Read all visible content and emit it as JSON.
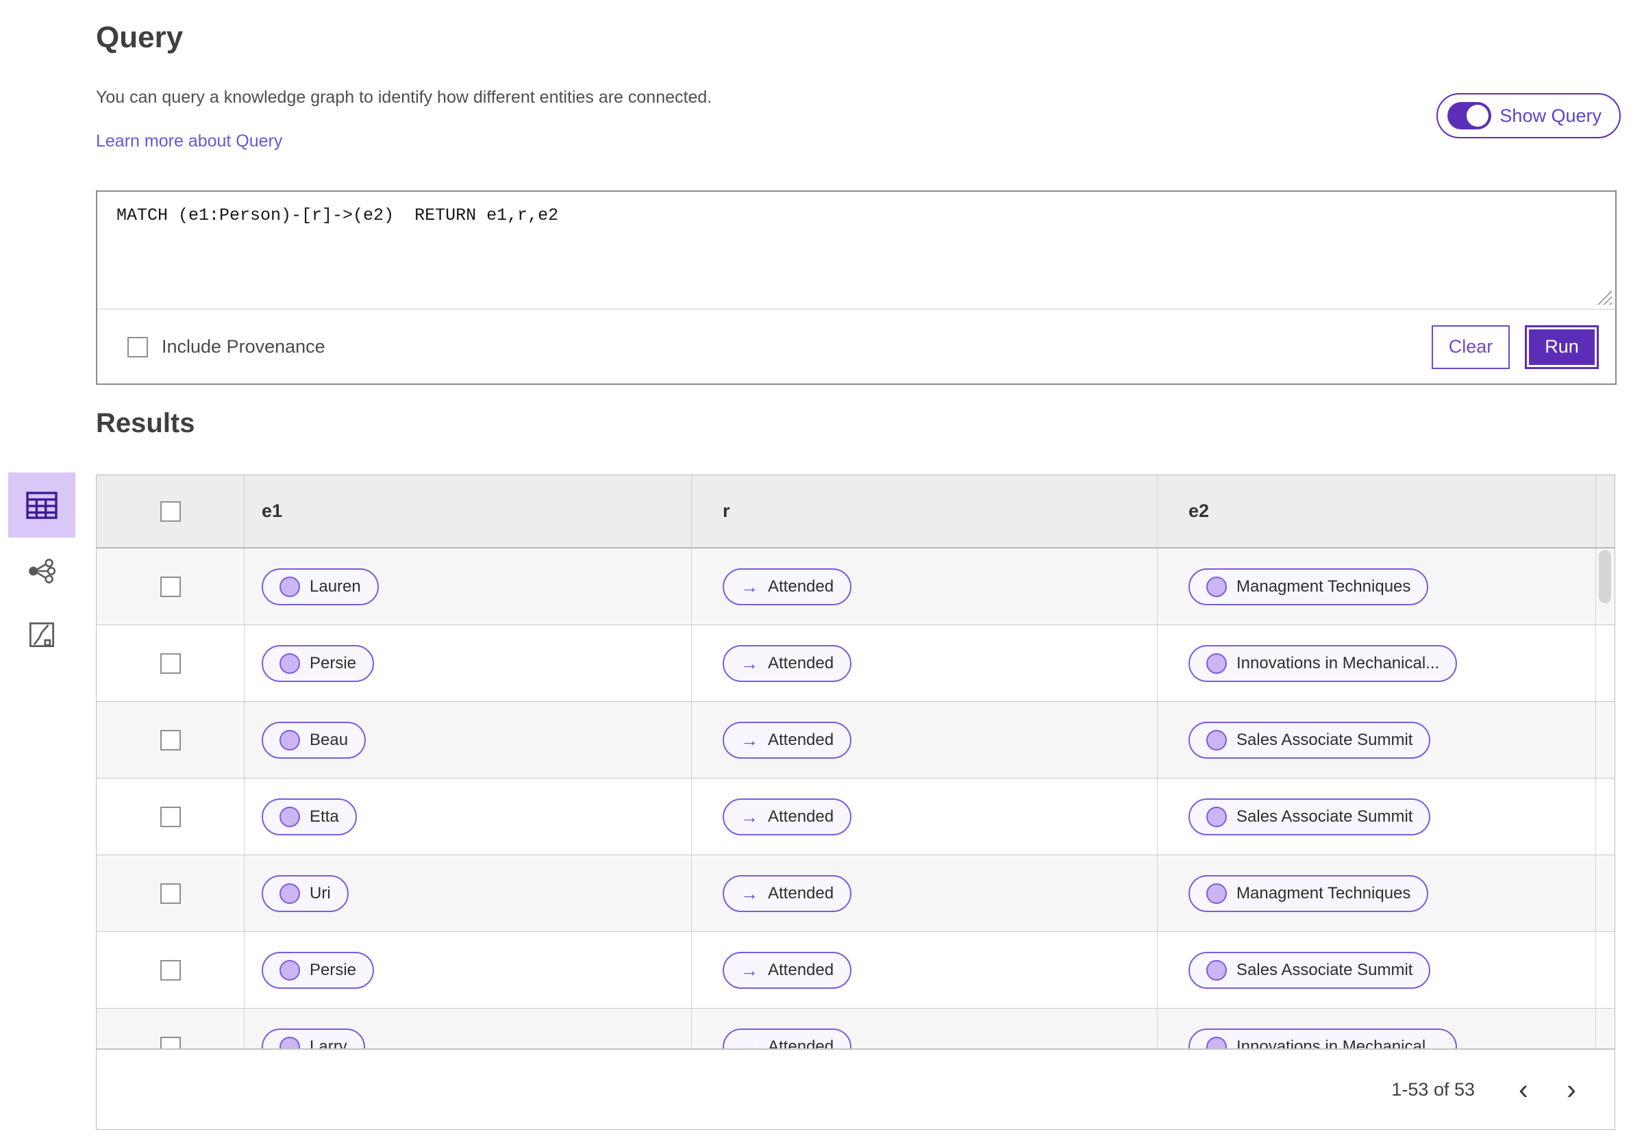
{
  "header": {
    "title": "Query",
    "description": "You can query a knowledge graph to identify how different entities are connected.",
    "learn_more": "Learn more about Query",
    "show_query_label": "Show Query",
    "show_query_state": "on"
  },
  "query_panel": {
    "query_text": "MATCH (e1:Person)-[r]->(e2)  RETURN e1,r,e2",
    "include_provenance_label": "Include Provenance",
    "include_provenance_checked": false,
    "clear_label": "Clear",
    "run_label": "Run"
  },
  "results": {
    "title": "Results",
    "views": [
      {
        "icon": "table-view-icon",
        "selected": true
      },
      {
        "icon": "graph-view-icon",
        "selected": false
      },
      {
        "icon": "chart-view-icon",
        "selected": false
      }
    ],
    "columns": [
      "e1",
      "r",
      "e2"
    ],
    "rows": [
      {
        "e1": "Lauren",
        "r": "Attended",
        "e2": "Managment Techniques"
      },
      {
        "e1": "Persie",
        "r": "Attended",
        "e2": "Innovations in Mechanical..."
      },
      {
        "e1": "Beau",
        "r": "Attended",
        "e2": "Sales Associate Summit"
      },
      {
        "e1": "Etta",
        "r": "Attended",
        "e2": "Sales Associate Summit"
      },
      {
        "e1": "Uri",
        "r": "Attended",
        "e2": "Managment Techniques"
      },
      {
        "e1": "Persie",
        "r": "Attended",
        "e2": "Sales Associate Summit"
      },
      {
        "e1": "Larry",
        "r": "Attended",
        "e2": "Innovations in Mechanical..."
      }
    ],
    "arrow_glyph": "→",
    "pagination": {
      "range_label": "1-53 of 53",
      "prev_glyph": "‹",
      "next_glyph": "›"
    }
  },
  "colors": {
    "accent_purple": "#5c2eb8",
    "pill_border": "#7a5ce0",
    "pill_background": "#f8f6fe",
    "node_fill": "#cbb6f3",
    "selected_view_background": "#d9c7f8",
    "link": "#6a55da",
    "header_row_background": "#ededed",
    "alt_row_background": "#f6f6f6"
  }
}
